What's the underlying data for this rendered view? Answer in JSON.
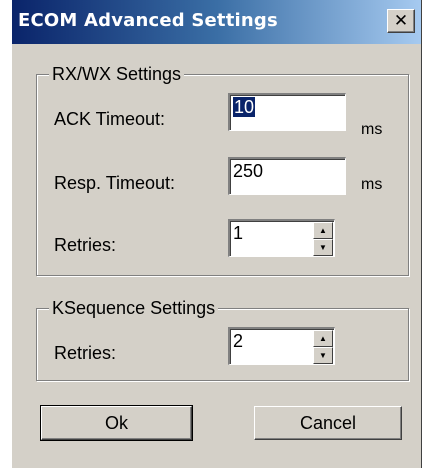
{
  "window": {
    "title": "ECOM Advanced Settings",
    "close_glyph": "✕",
    "close_icon": "close-icon"
  },
  "rxwx_group": {
    "legend": "RX/WX Settings",
    "ack_timeout": {
      "label": "ACK Timeout:",
      "value": "10",
      "unit": "ms"
    },
    "resp_timeout": {
      "label": "Resp. Timeout:",
      "value": "250",
      "unit": "ms"
    },
    "retries": {
      "label": "Retries:",
      "value": "1"
    }
  },
  "ksequence_group": {
    "legend": "KSequence Settings",
    "retries": {
      "label": "Retries:",
      "value": "2"
    }
  },
  "buttons": {
    "ok": "Ok",
    "cancel": "Cancel"
  },
  "spinner_icons": {
    "up": "spin-up-icon",
    "down": "spin-down-icon"
  },
  "colors": {
    "titlebar_start": "#0a246a",
    "titlebar_end": "#a6caf0",
    "face": "#d4d0c8"
  }
}
